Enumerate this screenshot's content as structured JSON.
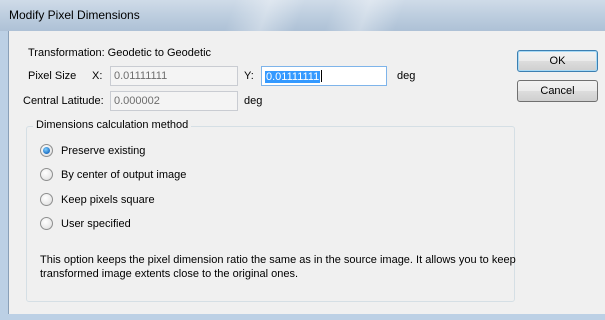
{
  "window": {
    "title": "Modify Pixel Dimensions"
  },
  "transformation": {
    "text": "Transformation: Geodetic to Geodetic"
  },
  "pixel_size": {
    "label": "Pixel Size",
    "x_label": "X:",
    "x_value": "0.01111111",
    "y_label": "Y:",
    "y_value": "0.01111111",
    "unit": "deg"
  },
  "central_latitude": {
    "label": "Central Latitude:",
    "value": "0.000002",
    "unit": "deg"
  },
  "buttons": {
    "ok": "OK",
    "cancel": "Cancel"
  },
  "method_group": {
    "label": "Dimensions calculation method",
    "options": [
      {
        "label": "Preserve existing",
        "checked": true
      },
      {
        "label": "By center of output image",
        "checked": false
      },
      {
        "label": "Keep pixels square",
        "checked": false
      },
      {
        "label": "User specified",
        "checked": false
      }
    ],
    "description": "This option keeps the pixel dimension ratio the same as in the source image. It allows you to keep transformed image extents close to the original ones."
  }
}
